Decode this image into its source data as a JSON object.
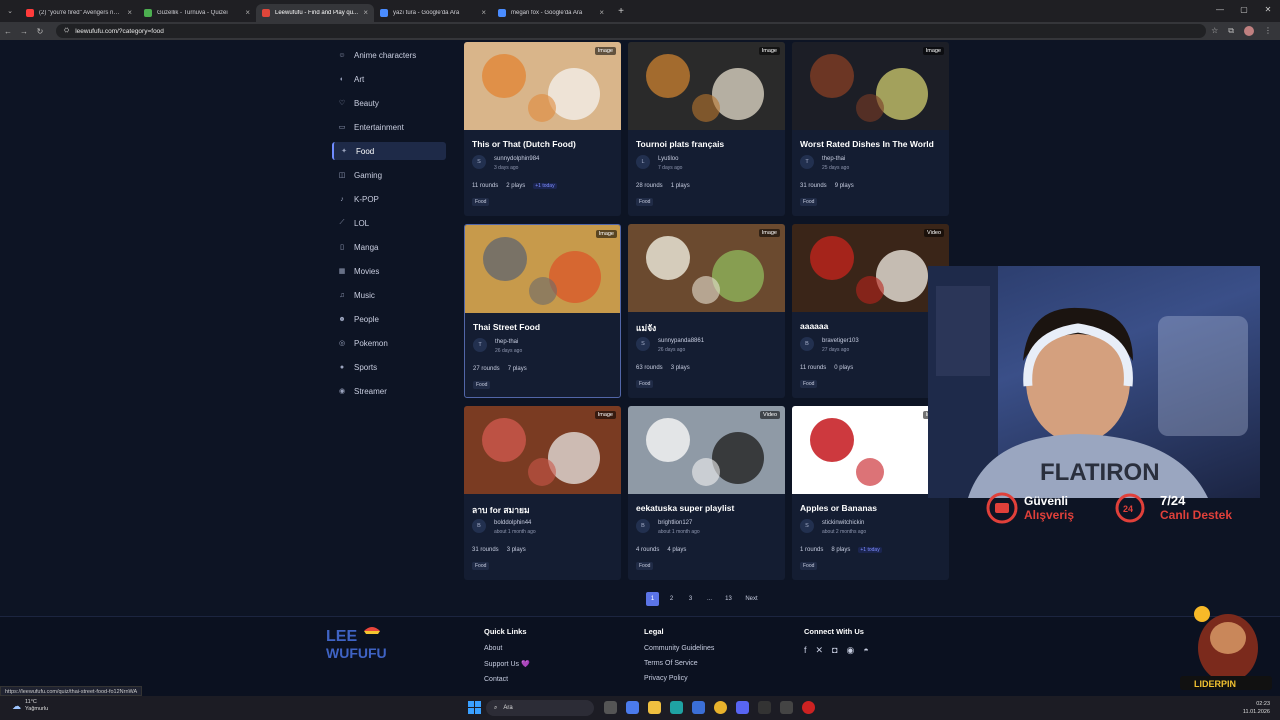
{
  "browser": {
    "tabs": [
      {
        "title": "(2) \"you're fired\" Avengers nat...",
        "color": "#ff3b3b",
        "active": false
      },
      {
        "title": "Güzellik - Turnuva - Quizei",
        "color": "#4caf50",
        "active": false
      },
      {
        "title": "Leewufufu - Find and Play qu...",
        "color": "#e0463a",
        "active": true
      },
      {
        "title": "yazı tura - Google'da Ara",
        "color": "#4a8cff",
        "active": false
      },
      {
        "title": "megan fox - Google'da Ara",
        "color": "#4a8cff",
        "active": false
      }
    ],
    "url": "leewufufu.com/?category=food"
  },
  "sidebar": {
    "items": [
      {
        "label": "Anime characters",
        "icon": "anime-icon",
        "glyph": "☺"
      },
      {
        "label": "Art",
        "icon": "palette-icon",
        "glyph": "◐"
      },
      {
        "label": "Beauty",
        "icon": "heart-icon",
        "glyph": "♡"
      },
      {
        "label": "Entertainment",
        "icon": "tv-icon",
        "glyph": "▭"
      },
      {
        "label": "Food",
        "icon": "food-icon",
        "glyph": "✦",
        "active": true
      },
      {
        "label": "Gaming",
        "icon": "gamepad-icon",
        "glyph": "◫"
      },
      {
        "label": "K-POP",
        "icon": "music-note-icon",
        "glyph": "♪"
      },
      {
        "label": "LOL",
        "icon": "sword-icon",
        "glyph": "⟋"
      },
      {
        "label": "Manga",
        "icon": "book-icon",
        "glyph": "▯"
      },
      {
        "label": "Movies",
        "icon": "film-icon",
        "glyph": "▦"
      },
      {
        "label": "Music",
        "icon": "music-icon",
        "glyph": "♫"
      },
      {
        "label": "People",
        "icon": "people-icon",
        "glyph": "☻"
      },
      {
        "label": "Pokemon",
        "icon": "pokeball-icon",
        "glyph": "◎"
      },
      {
        "label": "Sports",
        "icon": "ball-icon",
        "glyph": "●"
      },
      {
        "label": "Streamer",
        "icon": "stream-icon",
        "glyph": "◉"
      }
    ]
  },
  "cards": [
    {
      "title": "This or That (Dutch Food)",
      "badge": "Image",
      "initial": "S",
      "author": "sunnydolphin984",
      "ago": "3 days ago",
      "rounds": "11 rounds",
      "plays": "2 plays",
      "today": "+1 today",
      "tag": "Food",
      "colors": [
        "#d9b58a",
        "#e08a3c",
        "#f2efe8"
      ]
    },
    {
      "title": "Tournoi plats français",
      "badge": "Image",
      "initial": "L",
      "author": "Lyutiloo",
      "ago": "7 days ago",
      "rounds": "28 rounds",
      "plays": "1 plays",
      "today": "",
      "tag": "Food",
      "colors": [
        "#2a2a2a",
        "#b9772f",
        "#d8d1c0"
      ]
    },
    {
      "title": "Worst Rated Dishes In The World",
      "badge": "Image",
      "initial": "T",
      "author": "thep-thai",
      "ago": "25 days ago",
      "rounds": "31 rounds",
      "plays": "9 plays",
      "today": "",
      "tag": "Food",
      "colors": [
        "#1c1e26",
        "#7a3b24",
        "#c6c26a"
      ]
    },
    {
      "title": "Thai Street Food",
      "badge": "Image",
      "initial": "T",
      "author": "thep-thai",
      "ago": "26 days ago",
      "rounds": "27 rounds",
      "plays": "7 plays",
      "today": "",
      "tag": "Food",
      "colors": [
        "#c79a4b",
        "#6b6b6b",
        "#d95a2b"
      ]
    },
    {
      "title": "แม่จัง",
      "badge": "Image",
      "initial": "S",
      "author": "sunnypanda8861",
      "ago": "26 days ago",
      "rounds": "63 rounds",
      "plays": "3 plays",
      "today": "",
      "tag": "Food",
      "colors": [
        "#6b4a2f",
        "#e8e3d4",
        "#8fb35a"
      ]
    },
    {
      "title": "aaaaaa",
      "badge": "Video",
      "initial": "B",
      "author": "bravetiger103",
      "ago": "27 days ago",
      "rounds": "11 rounds",
      "plays": "0 plays",
      "today": "",
      "tag": "Food",
      "colors": [
        "#3a2518",
        "#b8241c",
        "#e9e2da"
      ]
    },
    {
      "title": "ลาบ for สมายม",
      "badge": "Image",
      "initial": "B",
      "author": "bolddolphin44",
      "ago": "about 1 month ago",
      "rounds": "31 rounds",
      "plays": "3 plays",
      "today": "",
      "tag": "Food",
      "colors": [
        "#7a3b22",
        "#c9574a",
        "#e2dcd8"
      ]
    },
    {
      "title": "eekatuska super playlist",
      "badge": "Video",
      "initial": "B",
      "author": "brightlion127",
      "ago": "about 1 month ago",
      "rounds": "4 rounds",
      "plays": "4 plays",
      "today": "",
      "tag": "Food",
      "colors": [
        "#8f9aa6",
        "#f2f2f2",
        "#222"
      ]
    },
    {
      "title": "Apples or Bananas",
      "badge": "Image",
      "initial": "S",
      "author": "stickinwitchickin",
      "ago": "about 2 months ago",
      "rounds": "1 rounds",
      "plays": "8 plays",
      "today": "+1 today",
      "tag": "Food",
      "colors": [
        "#ffffff",
        "#c4161c",
        "#ffffff"
      ]
    }
  ],
  "pagination": {
    "pages": [
      "1",
      "2",
      "3",
      "...",
      "13"
    ],
    "next": "Next"
  },
  "footer": {
    "logo_line1": "LEE",
    "logo_line2": "WUFUFU",
    "quick_links_title": "Quick Links",
    "quick_links": [
      "About",
      "Support Us 💜",
      "Contact"
    ],
    "legal_title": "Legal",
    "legal": [
      "Community Guidelines",
      "Terms Of Service",
      "Privacy Policy"
    ],
    "connect_title": "Connect With Us"
  },
  "status_url": "https://leewufufu.com/quiz/thai-street-food-fo12NrnWA",
  "overlay": {
    "shirt_text": "FLATIRON",
    "promo1_line1": "Güvenli",
    "promo1_line2": "Alışveriş",
    "promo2_line1": "7/24",
    "promo2_line2": "Canlı Destek",
    "promo2_badge": "24",
    "brand": "LIDERPIN"
  },
  "taskbar": {
    "weather_temp": "11°C",
    "weather_desc": "Yağmurlu",
    "search_label": "Ara",
    "time": "02:23",
    "date": "11.01.2026"
  }
}
